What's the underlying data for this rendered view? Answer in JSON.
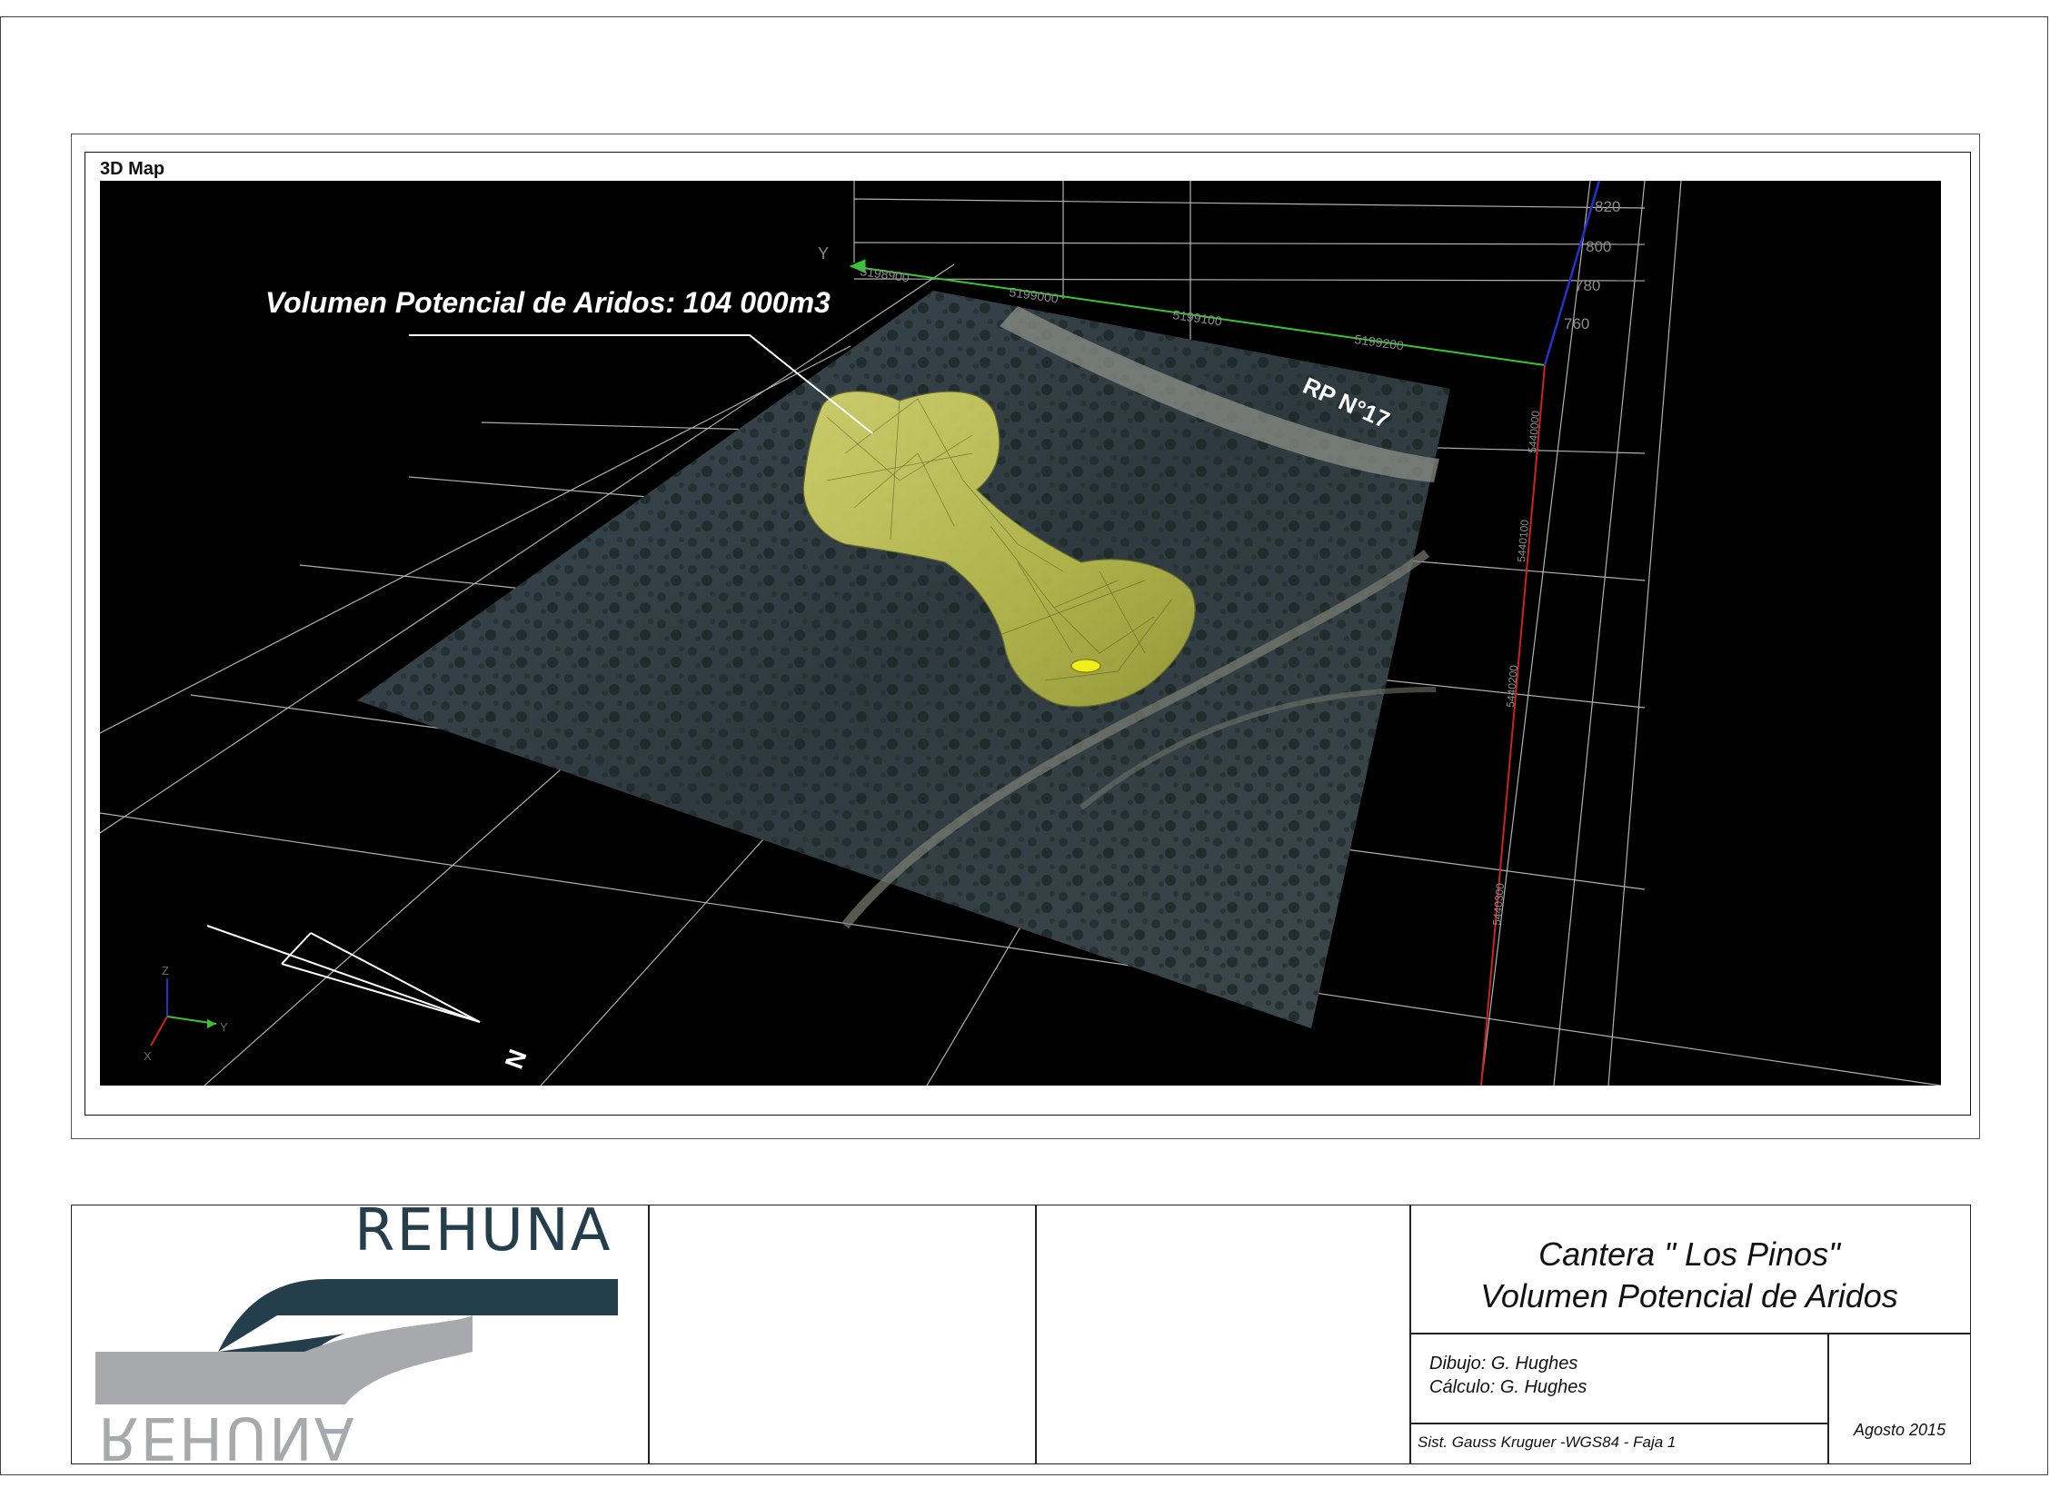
{
  "map": {
    "caption": "3D Map",
    "volume_label": "Volumen Potencial de Aridos: 104 000m3",
    "road_label": "RP N°17",
    "north_label": "N",
    "y_axis_label": "Y",
    "y_ticks": [
      "5199000",
      "5199100",
      "5199200"
    ],
    "y_start_tick": "5198900",
    "z_ticks": [
      "820",
      "800",
      "780",
      "760"
    ],
    "x_ticks": [
      "5440000",
      "5440100",
      "5440200",
      "5440300"
    ],
    "gizmo": {
      "z": "Z",
      "y": "Y",
      "x": "X"
    },
    "colors": {
      "background": "#000000",
      "y_axis": "#35c535",
      "x_axis": "#cc2222",
      "z_axis": "#2233cc",
      "body": "#c9cc5a"
    }
  },
  "title_block": {
    "logo_text": "REHUNA",
    "logo_text_mirrored": "REHUNA",
    "title_line1": "Cantera \" Los Pinos\"",
    "title_line2": "Volumen Potencial de Aridos",
    "drawn_by": "Dibujo: G. Hughes",
    "calculated_by": "Cálculo: G. Hughes",
    "coordinate_system": "Sist. Gauss Kruguer -WGS84 - Faja 1",
    "date": "Agosto 2015",
    "colors": {
      "logo_dark": "#243f4b",
      "logo_light": "#a7a9ac"
    }
  }
}
